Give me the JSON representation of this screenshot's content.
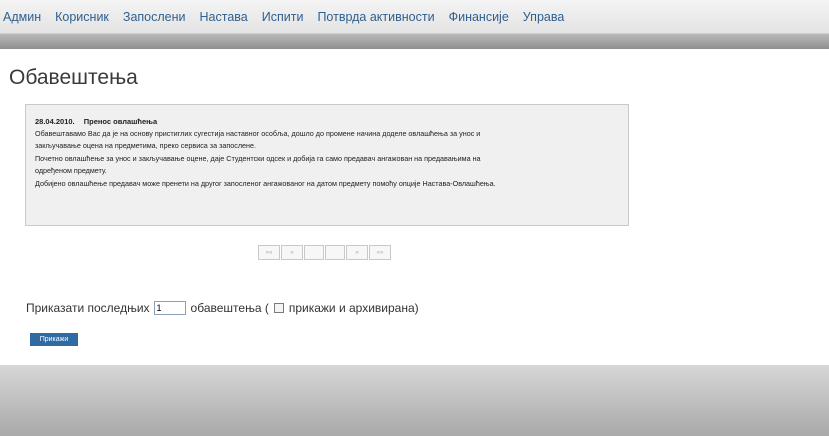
{
  "nav": {
    "items": [
      "Админ",
      "Корисник",
      "Запослени",
      "Настава",
      "Испити",
      "Потврда активности",
      "Финансије",
      "Управа"
    ]
  },
  "page": {
    "title": "Обавештења"
  },
  "notice": {
    "date": "28.04.2010.",
    "title": "Пренос овлашћења",
    "lines": [
      "Обавештавамо Вас да је на основу пристиглих сугестија наставног особља, дошло до промене начина доделе овлашћења за унос и",
      "закључавање оцена на предметима, преко сервиса за запослене.",
      "Почетно овлашћење за унос и закључавање оцене, даје Студентски одсек и добија га само предавач ангажован на предавањима на",
      "одређеном предмету.",
      "Добијено овлашћење предавач може пренети на другог запосленог ангажованог на датом предмету помоћу опције Настава-Овлашћења."
    ]
  },
  "pager": {
    "first": "««",
    "prev": "«",
    "next": "»",
    "last": "»»"
  },
  "form": {
    "prefix": "Приказати последњих",
    "count_value": "1",
    "suffix": "обавештења (",
    "checkbox_label": "прикажи и архивирана)",
    "button_label": "Прикажи"
  }
}
